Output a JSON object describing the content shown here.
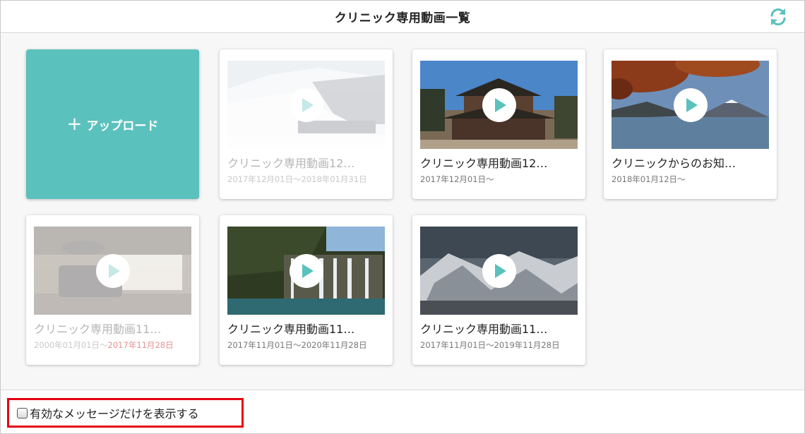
{
  "header": {
    "title": "クリニック専用動画一覧",
    "refresh_icon": "refresh-icon",
    "accent_color": "#5bc1bd"
  },
  "upload": {
    "plus": "+",
    "label": "アップロード"
  },
  "videos": [
    {
      "title": "クリニック専用動画12…",
      "date_start": "2017年12月01日〜2018年01月31日",
      "date_end": "",
      "state": "disabled",
      "thumbnail": "ski-slope"
    },
    {
      "title": "クリニック専用動画12…",
      "date_start": "2017年12月01日〜",
      "date_end": "",
      "state": "active",
      "thumbnail": "temple"
    },
    {
      "title": "クリニックからのお知…",
      "date_start": "2018年01月12日〜",
      "date_end": "",
      "state": "active",
      "thumbnail": "lake-mountain"
    },
    {
      "title": "クリニック専用動画11…",
      "date_start": "2000年01月01日〜",
      "date_end": "2017年11月28日",
      "state": "expired",
      "thumbnail": "interior"
    },
    {
      "title": "クリニック専用動画11…",
      "date_start": "2017年11月01日〜2020年11月28日",
      "date_end": "",
      "state": "active",
      "thumbnail": "waterfall"
    },
    {
      "title": "クリニック専用動画11…",
      "date_start": "2017年11月01日〜2019年11月28日",
      "date_end": "",
      "state": "active",
      "thumbnail": "snow-mountains"
    }
  ],
  "filter": {
    "label": "有効なメッセージだけを表示する",
    "checked": false,
    "highlight_color": "#e50012"
  }
}
